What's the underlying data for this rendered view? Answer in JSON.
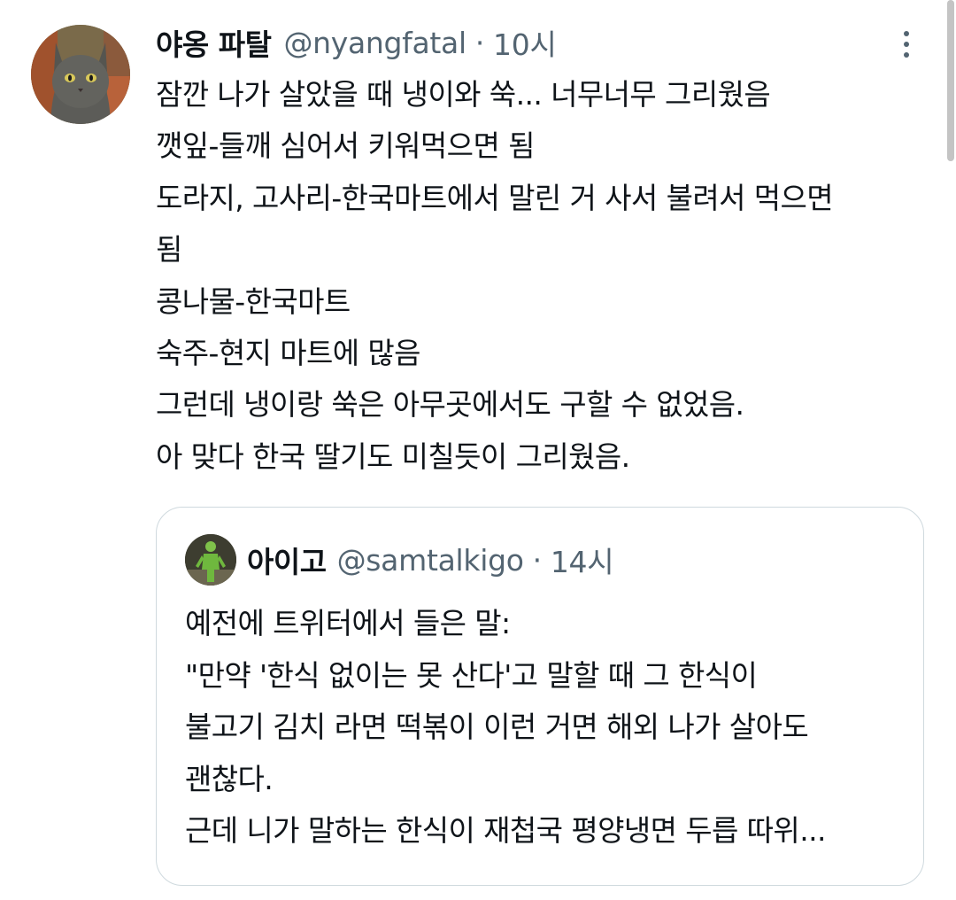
{
  "tweet": {
    "author_name": "야옹 파탈",
    "handle": "@nyangfatal",
    "separator": "·",
    "time": "10시",
    "lines": [
      "잠깐 나가 살았을 때 냉이와 쑥... 너무너무 그리웠음",
      "깻잎-들깨 심어서 키워먹으면 됨",
      "도라지, 고사리-한국마트에서 말린 거 사서 불려서 먹으면",
      "됨",
      "콩나물-한국마트",
      "숙주-현지 마트에 많음",
      "그런데 냉이랑 쑥은 아무곳에서도 구할 수 없었음.",
      "아 맞다 한국 딸기도 미칠듯이 그리웠음."
    ]
  },
  "quote": {
    "author_name": "아이고",
    "handle": "@samtalkigo",
    "separator": "·",
    "time": "14시",
    "lines": [
      "예전에 트위터에서 들은 말:",
      "\"만약 '한식 없이는 못 산다'고 말할 때 그 한식이",
      "불고기 김치 라면 떡볶이 이런 거면 해외 나가 살아도",
      "괜찮다.",
      "근데 니가 말하는 한식이 재첩국 평양냉면 두릅 따위..."
    ]
  },
  "icons": {
    "more": "more-vertical-icon"
  },
  "colors": {
    "text": "#0f1419",
    "secondary": "#536471",
    "border": "#cfd9de"
  }
}
